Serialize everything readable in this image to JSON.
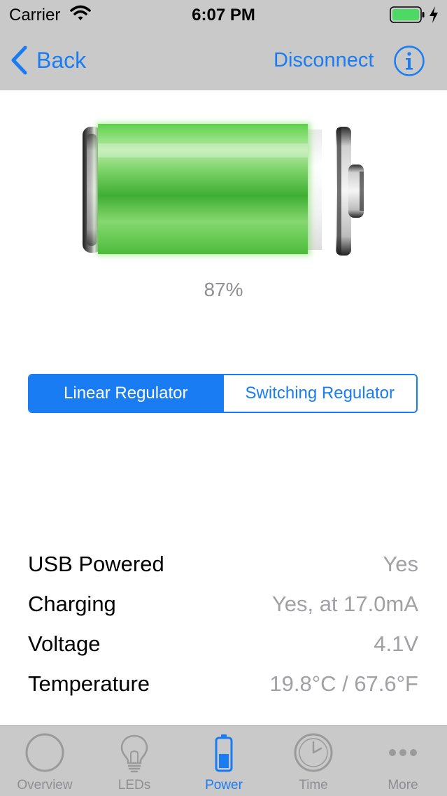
{
  "status_bar": {
    "carrier": "Carrier",
    "time": "6:07 PM"
  },
  "nav": {
    "back_label": "Back",
    "disconnect_label": "Disconnect"
  },
  "battery": {
    "percent_text": "87%",
    "level": 0.87,
    "fill_color": "#4fc13d"
  },
  "regulator": {
    "options": [
      "Linear Regulator",
      "Switching Regulator"
    ],
    "selected": "Linear Regulator"
  },
  "power_info": [
    {
      "label": "USB Powered",
      "value": "Yes"
    },
    {
      "label": "Charging",
      "value": "Yes, at 17.0mA"
    },
    {
      "label": "Voltage",
      "value": "4.1V"
    },
    {
      "label": "Temperature",
      "value": "19.8°C / 67.6°F"
    }
  ],
  "tabs": [
    {
      "label": "Overview",
      "icon": "circle-icon"
    },
    {
      "label": "LEDs",
      "icon": "lightbulb-icon"
    },
    {
      "label": "Power",
      "icon": "battery-icon",
      "active": true
    },
    {
      "label": "Time",
      "icon": "clock-icon"
    },
    {
      "label": "More",
      "icon": "more-icon"
    }
  ],
  "colors": {
    "accent": "#1a7cf2",
    "bar_background": "#c9c9c9",
    "secondary_text": "#a0a0a5"
  }
}
